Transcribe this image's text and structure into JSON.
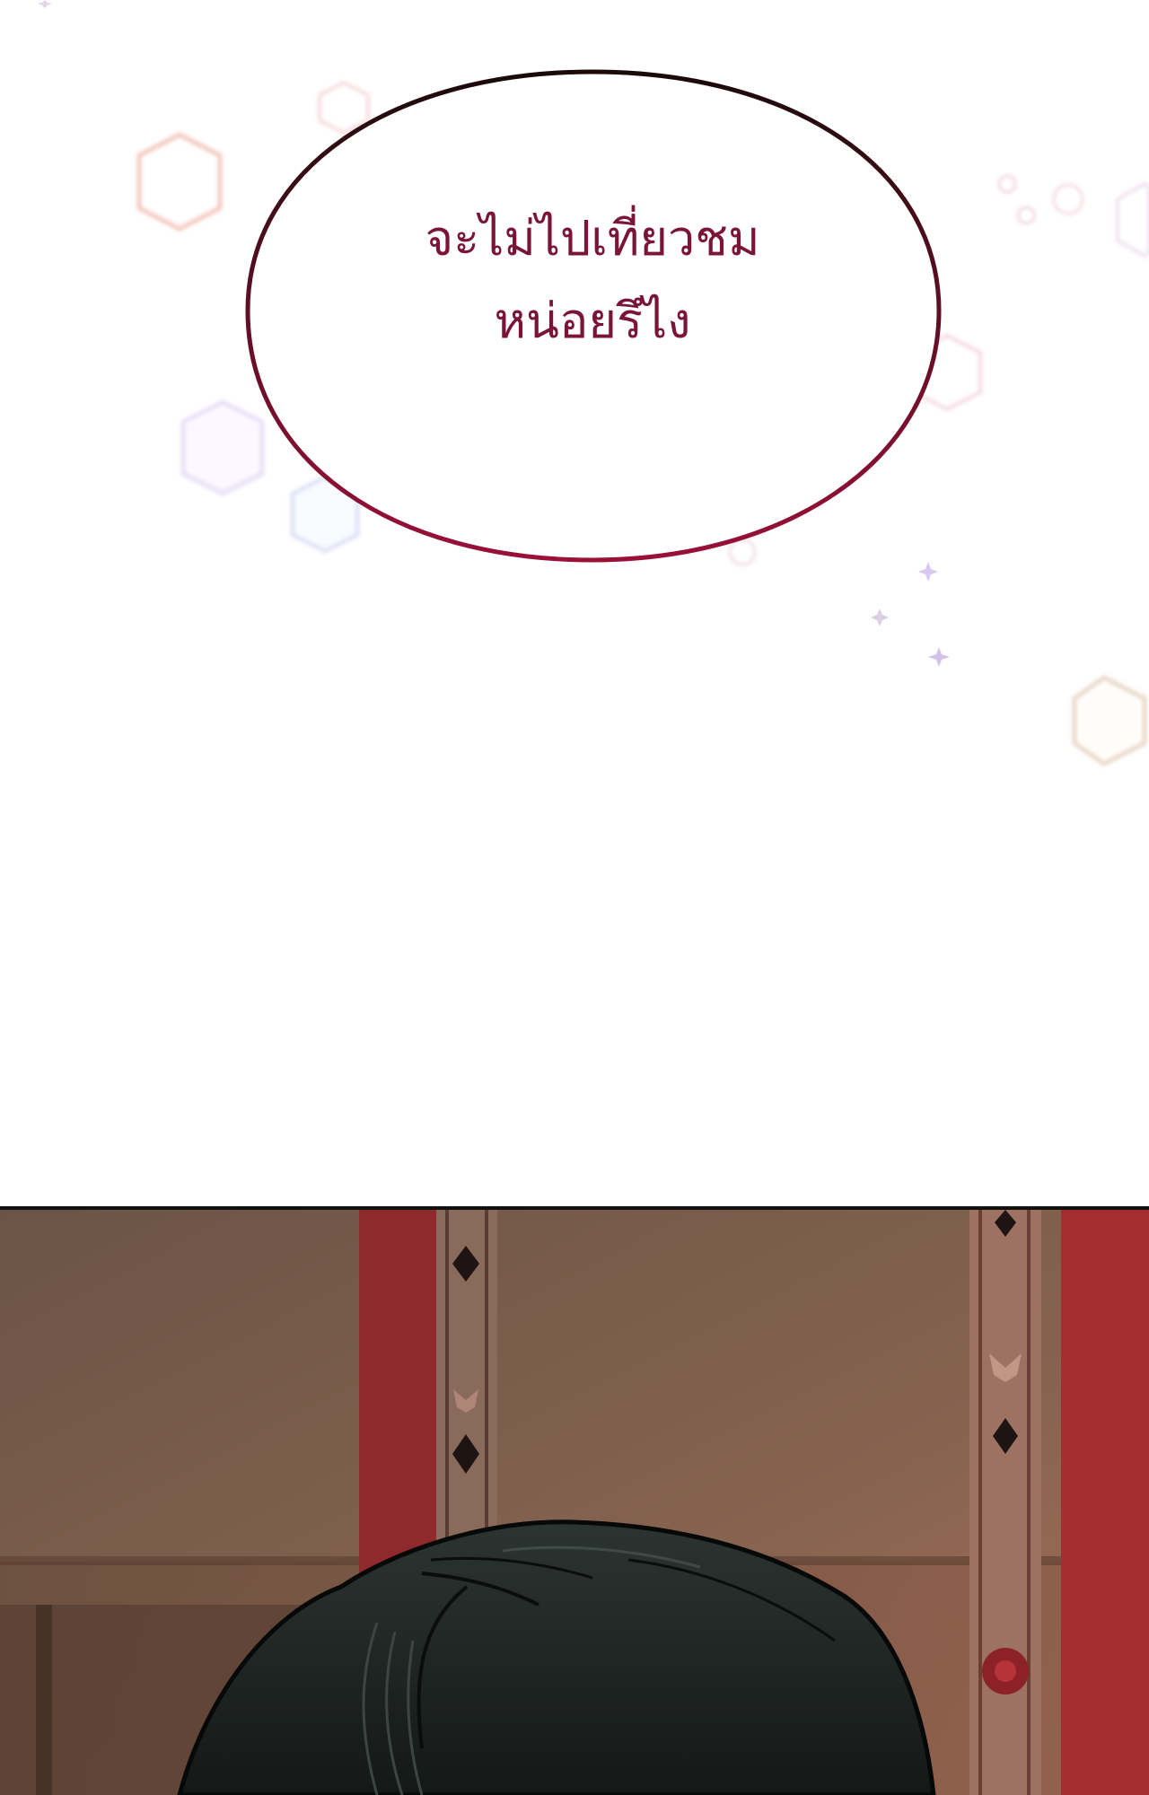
{
  "speech_bubble": {
    "line1": "จะไม่ไปเที่ยวชม",
    "line2": "หน่อยรึไง"
  },
  "colors": {
    "bubble_text": "#7a1536",
    "bubble_outline_top": "#1a0a0a",
    "bubble_outline_bottom": "#9a1038",
    "panel_border": "#111111",
    "wall": "#7a5c4c",
    "red_pillar": "#8e2a2c",
    "hair": "#1f2522"
  },
  "icons": {
    "bokeh": "hexagon-bokeh-icon",
    "sparkle": "sparkle-star-icon"
  }
}
